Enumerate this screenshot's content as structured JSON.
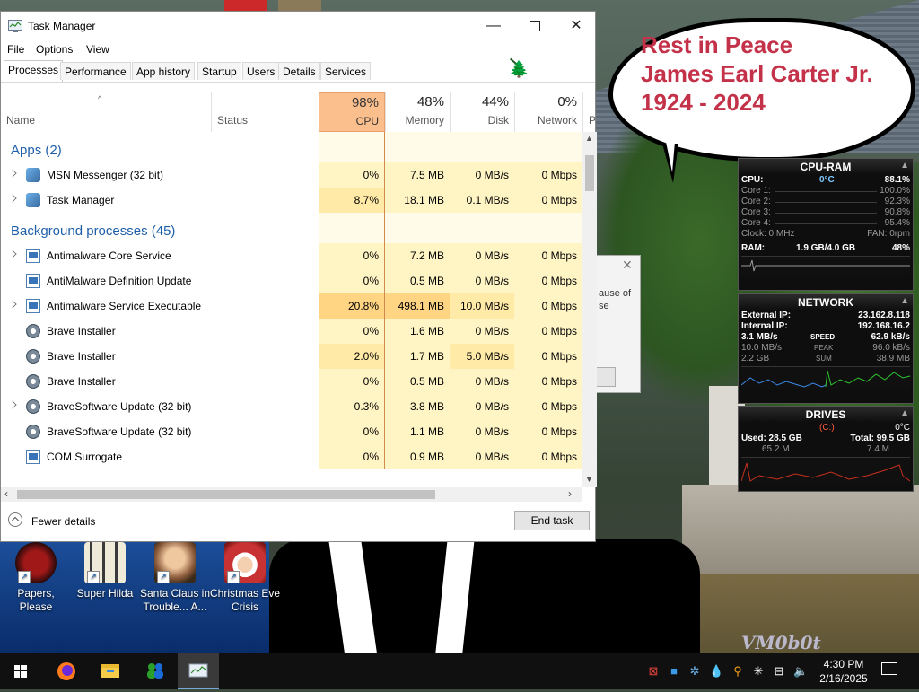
{
  "window": {
    "title": "Task Manager",
    "menu": [
      "File",
      "Options",
      "View"
    ],
    "tabs": [
      "Processes",
      "Performance",
      "App history",
      "Startup",
      "Users",
      "Details",
      "Services"
    ],
    "active_tab": "Processes",
    "controls": {
      "minimize": "—",
      "close": "✕"
    }
  },
  "columns": {
    "name": "Name",
    "status": "Status",
    "cpu": {
      "label": "CPU",
      "pct": "98%"
    },
    "memory": {
      "label": "Memory",
      "pct": "48%"
    },
    "disk": {
      "label": "Disk",
      "pct": "44%"
    },
    "network": {
      "label": "Network",
      "pct": "0%"
    },
    "more": "P"
  },
  "groups": {
    "apps": "Apps (2)",
    "background": "Background processes (45)"
  },
  "apps": [
    {
      "name": "MSN Messenger (32 bit)",
      "cpu": "0%",
      "memory": "7.5 MB",
      "disk": "0 MB/s",
      "network": "0 Mbps",
      "icon": "msn-icon"
    },
    {
      "name": "Task Manager",
      "cpu": "8.7%",
      "memory": "18.1 MB",
      "disk": "0.1 MB/s",
      "network": "0 Mbps",
      "icon": "task-manager-icon"
    }
  ],
  "background": [
    {
      "name": "Antimalware Core Service",
      "cpu": "0%",
      "memory": "7.2 MB",
      "disk": "0 MB/s",
      "network": "0 Mbps",
      "icon": "service-icon"
    },
    {
      "name": "AntiMalware Definition Update",
      "cpu": "0%",
      "memory": "0.5 MB",
      "disk": "0 MB/s",
      "network": "0 Mbps",
      "icon": "service-icon"
    },
    {
      "name": "Antimalware Service Executable",
      "cpu": "20.8%",
      "memory": "498.1 MB",
      "disk": "10.0 MB/s",
      "network": "0 Mbps",
      "icon": "service-icon"
    },
    {
      "name": "Brave Installer",
      "cpu": "0%",
      "memory": "1.6 MB",
      "disk": "0 MB/s",
      "network": "0 Mbps",
      "icon": "installer-icon"
    },
    {
      "name": "Brave Installer",
      "cpu": "2.0%",
      "memory": "1.7 MB",
      "disk": "5.0 MB/s",
      "network": "0 Mbps",
      "icon": "installer-icon"
    },
    {
      "name": "Brave Installer",
      "cpu": "0%",
      "memory": "0.5 MB",
      "disk": "0 MB/s",
      "network": "0 Mbps",
      "icon": "installer-icon"
    },
    {
      "name": "BraveSoftware Update (32 bit)",
      "cpu": "0.3%",
      "memory": "3.8 MB",
      "disk": "0 MB/s",
      "network": "0 Mbps",
      "icon": "updater-icon"
    },
    {
      "name": "BraveSoftware Update (32 bit)",
      "cpu": "0%",
      "memory": "1.1 MB",
      "disk": "0 MB/s",
      "network": "0 Mbps",
      "icon": "updater-icon"
    },
    {
      "name": "COM Surrogate",
      "cpu": "0%",
      "memory": "0.9 MB",
      "disk": "0 MB/s",
      "network": "0 Mbps",
      "icon": "service-icon"
    }
  ],
  "footer": {
    "fewer_details": "Fewer details",
    "end_task": "End task"
  },
  "dialog_behind": {
    "line1": "ause of",
    "line2": "se"
  },
  "bubble": {
    "lines": [
      "Rest in Peace",
      "James Earl Carter Jr.",
      "1924 - 2024"
    ]
  },
  "gadget_cpu": {
    "title": "CPU-RAM",
    "cpu_label": "CPU:",
    "temp": "0°C",
    "cpu_pct": "88.1%",
    "cores": [
      {
        "label": "Core 1:",
        "value": "100.0%"
      },
      {
        "label": "Core 2:",
        "value": "92.3%"
      },
      {
        "label": "Core 3:",
        "value": "90.8%"
      },
      {
        "label": "Core 4:",
        "value": "95.4%"
      }
    ],
    "clock": "Clock: 0 MHz",
    "fan": "FAN: 0rpm",
    "ram_label": "RAM:",
    "ram_value": "1.9 GB/4.0 GB",
    "ram_pct": "48%"
  },
  "gadget_net": {
    "title": "NETWORK",
    "external_label": "External IP:",
    "external_ip": "23.162.8.118",
    "internal_label": "Internal IP:",
    "internal_ip": "192.168.16.2",
    "speed": {
      "left": "3.1 MB/s",
      "mid": "SPEED",
      "right": "62.9 kB/s"
    },
    "peak": {
      "left": "10.0 MB/s",
      "mid": "PEAK",
      "right": "96.0 kB/s"
    },
    "sum": {
      "left": "2.2 GB",
      "mid": "SUM",
      "right": "38.9 MB"
    }
  },
  "gadget_drv": {
    "title": "DRIVES",
    "drive": "(C:)",
    "temp": "0°C",
    "used": "Used: 28.5 GB",
    "total": "Total: 99.5 GB",
    "read": "65.2 M",
    "write": "7.4 M"
  },
  "desktop_icons": [
    {
      "label_1": "Papers, Please",
      "label_2": "",
      "color": "#7a1414"
    },
    {
      "label_1": "Super Hilda",
      "label_2": "",
      "color": "#e8e0c8"
    },
    {
      "label_1": "Santa Claus in",
      "label_2": "Trouble... A...",
      "color": "#8a5a3a"
    },
    {
      "label_1": "Christmas Eve",
      "label_2": "Crisis",
      "color": "#c83232"
    }
  ],
  "taskbar": {
    "time": "4:30 PM",
    "date": "2/16/2025"
  },
  "watermark": "VM0b0t",
  "colors": {
    "cpu_header": "#fbbf8e",
    "group_title": "#1f5fa8",
    "bubble_text": "#c4324a"
  }
}
